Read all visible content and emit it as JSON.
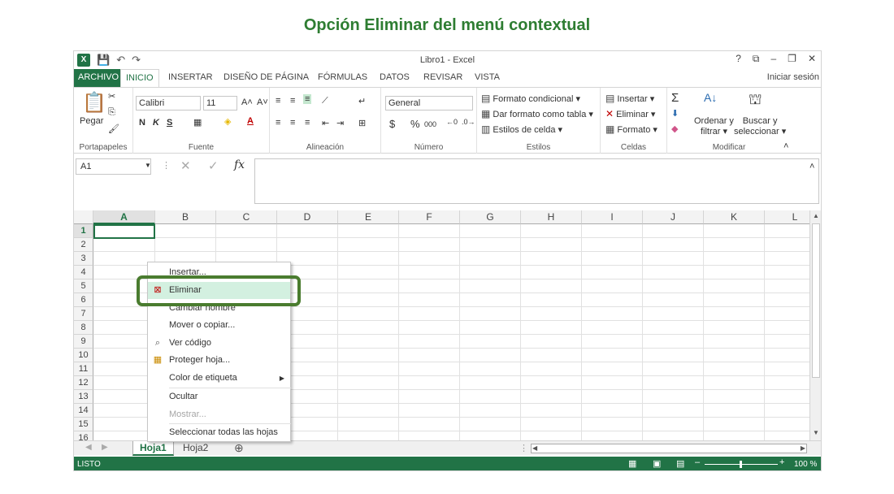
{
  "page_title": "Opción Eliminar del menú contextual",
  "window": {
    "title": "Libro1 - Excel",
    "controls": [
      "?",
      "⧉",
      "–",
      "❐",
      "✕"
    ],
    "qat_icons": [
      "excel-icon",
      "save-icon",
      "undo-icon",
      "redo-icon"
    ],
    "signin": "Iniciar sesión"
  },
  "tabs": [
    "ARCHIVO",
    "INICIO",
    "INSERTAR",
    "DISEÑO DE PÁGINA",
    "FÓRMULAS",
    "DATOS",
    "REVISAR",
    "VISTA"
  ],
  "ribbon": {
    "clipboard": {
      "paste": "Pegar",
      "label": "Portapapeles"
    },
    "font": {
      "name": "Calibri",
      "size": "11",
      "bold": "N",
      "italic": "K",
      "underline": "S",
      "label": "Fuente"
    },
    "alignment": {
      "label": "Alineación"
    },
    "number": {
      "format": "General",
      "currency": "$",
      "percent": "%",
      "thousands": "000",
      "label": "Número"
    },
    "styles": {
      "conditional": "Formato condicional",
      "table": "Dar formato como tabla",
      "cell": "Estilos de celda",
      "label": "Estilos"
    },
    "cells": {
      "insert": "Insertar",
      "delete": "Eliminar",
      "format": "Formato",
      "label": "Celdas"
    },
    "editing": {
      "sort1": "Ordenar y",
      "sort2": "filtrar",
      "find1": "Buscar y",
      "find2": "seleccionar",
      "label": "Modificar"
    }
  },
  "formula_bar": {
    "name_box": "A1",
    "fx": "fx"
  },
  "columns": [
    "A",
    "B",
    "C",
    "D",
    "E",
    "F",
    "G",
    "H",
    "I",
    "J",
    "K",
    "L"
  ],
  "rows": [
    "1",
    "2",
    "3",
    "4",
    "5",
    "6",
    "7",
    "8",
    "9",
    "10",
    "11",
    "12",
    "13",
    "14",
    "15",
    "16"
  ],
  "sheets": [
    "Hoja1",
    "Hoja2"
  ],
  "status": {
    "ready": "LISTO",
    "zoom": "100 %"
  },
  "context_menu": {
    "items": [
      "Insertar...",
      "Eliminar",
      "Cambiar nombre",
      "Mover o copiar...",
      "Ver código",
      "Proteger hoja...",
      "Color de etiqueta",
      "Ocultar",
      "Mostrar...",
      "Seleccionar todas las hojas"
    ]
  },
  "colors": {
    "excel_green": "#217346",
    "callout": "#4a7c2f",
    "highlight": "#d3f0e0"
  }
}
